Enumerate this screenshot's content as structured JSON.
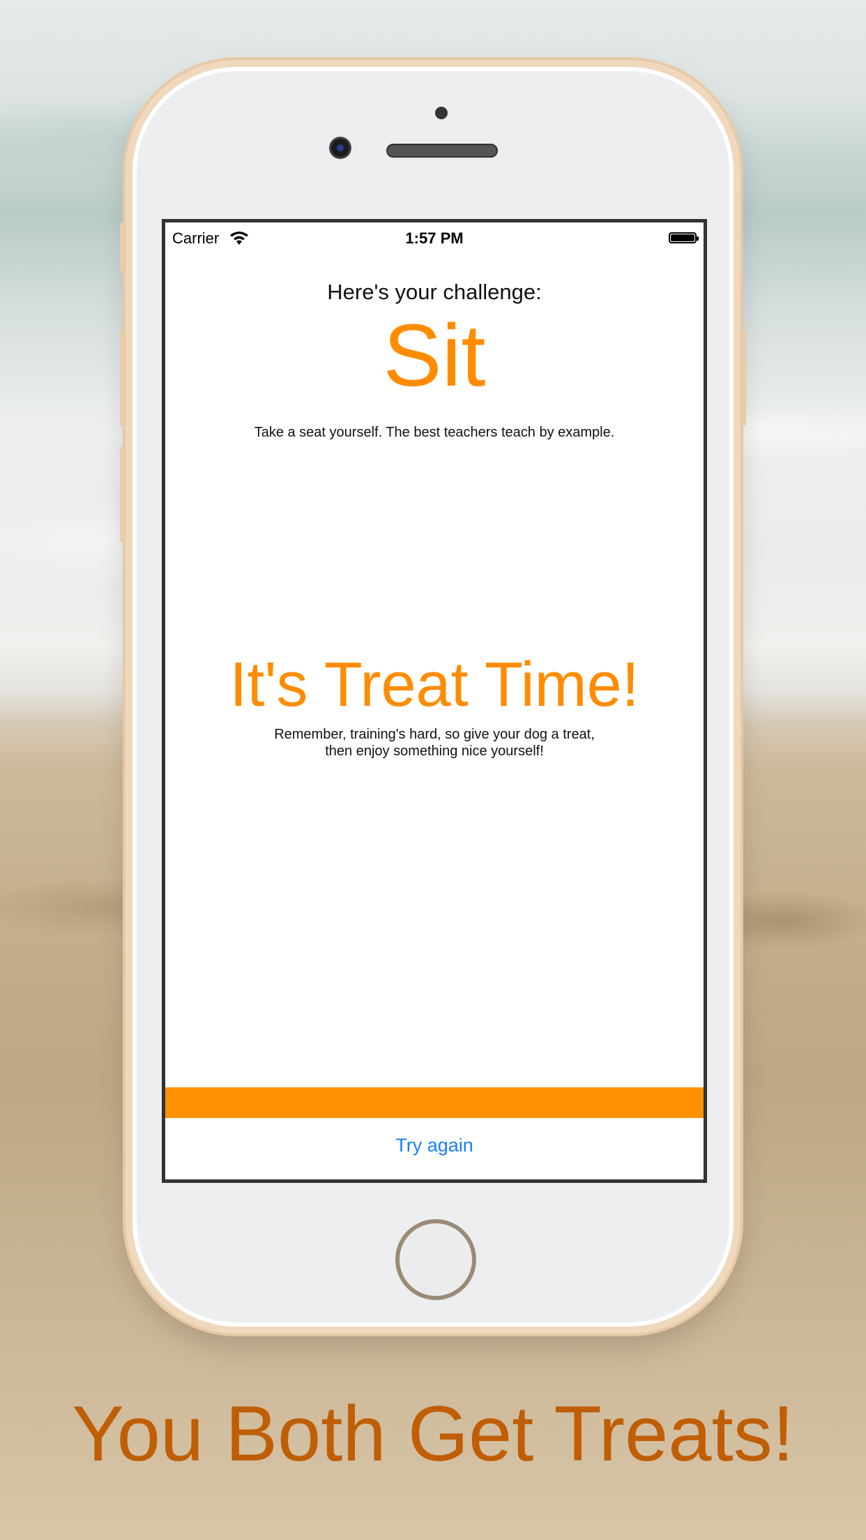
{
  "status_bar": {
    "carrier": "Carrier",
    "time": "1:57 PM"
  },
  "challenge": {
    "label": "Here's your challenge:",
    "command": "Sit",
    "description": "Take a seat yourself. The best teachers teach by example."
  },
  "treat": {
    "title": "It's Treat Time!",
    "line1": "Remember, training's hard, so give your dog a treat,",
    "line2": "then enjoy something nice yourself!"
  },
  "actions": {
    "try_again": "Try again"
  },
  "caption": "You Both Get Treats!",
  "colors": {
    "accent_orange": "#ff8c00",
    "link_blue": "#1a7ff5",
    "caption_brown": "#c05e06"
  }
}
